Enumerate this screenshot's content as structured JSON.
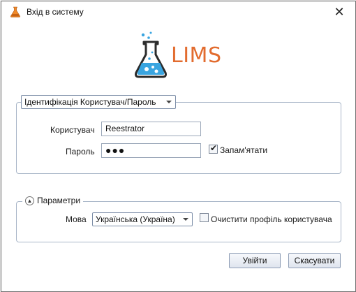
{
  "window": {
    "title": "Вхід в систему",
    "close_glyph": "✕"
  },
  "logo": {
    "text": "LIMS",
    "icon": "lab-flask-icon",
    "accent": "#e26c2f",
    "flask_color": "#2b2b2b",
    "bubble_color": "#3aa5e0"
  },
  "auth": {
    "mode": "Ідентифікація Користувач/Пароль",
    "user_label": "Користувач",
    "user_value": "Reestrator",
    "password_label": "Пароль",
    "password_mask": "●●●",
    "remember_label": "Запам'ятати",
    "remember_checked": true
  },
  "params": {
    "legend": "Параметри",
    "expander_glyph": "▲",
    "language_label": "Мова",
    "language_value": "Українська (Україна)",
    "clear_profile_label": "Очистити профіль користувача",
    "clear_profile_checked": false
  },
  "buttons": {
    "login": "Увійти",
    "cancel": "Скасувати"
  }
}
